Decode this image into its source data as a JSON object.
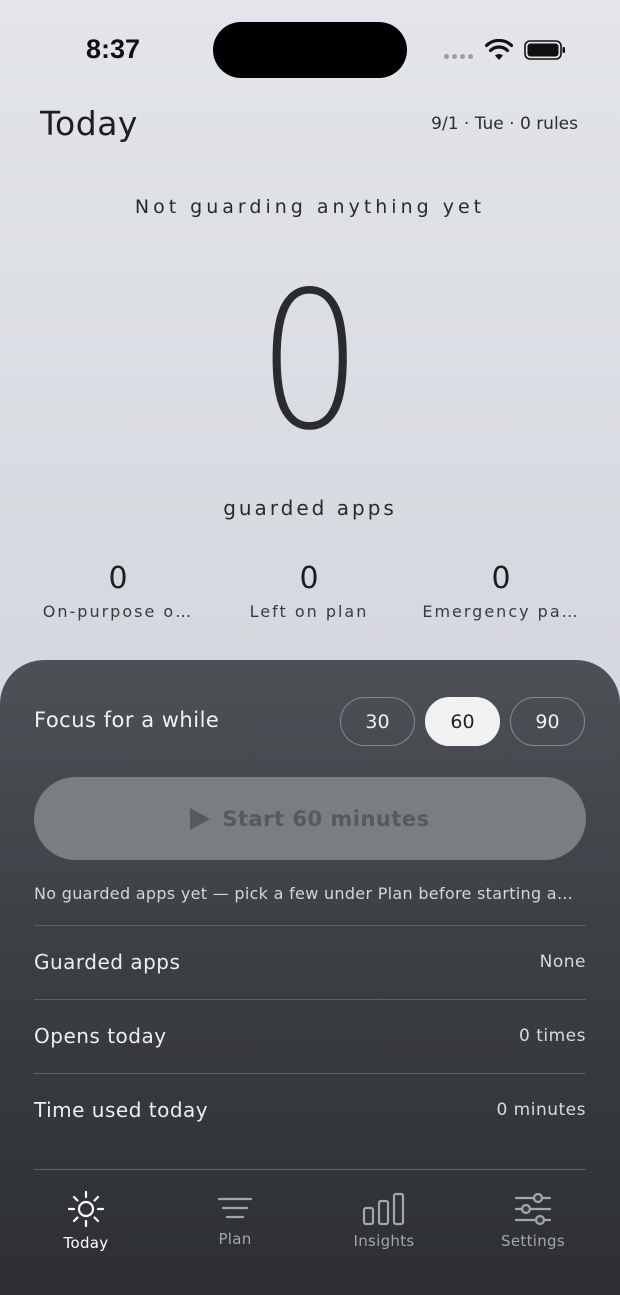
{
  "status_bar": {
    "time": "8:37"
  },
  "header": {
    "title": "Today",
    "date_rules": "9/1 · Tue · 0 rules"
  },
  "hero": {
    "status": "Not guarding anything yet",
    "count": "0",
    "count_label": "guarded apps"
  },
  "stats": [
    {
      "value": "0",
      "label": "On-purpose o…"
    },
    {
      "value": "0",
      "label": "Left on plan"
    },
    {
      "value": "0",
      "label": "Emergency pa…"
    }
  ],
  "focus": {
    "label": "Focus for a while",
    "durations": [
      "30",
      "60",
      "90"
    ],
    "selected_duration": "60",
    "start_label": "Start 60 minutes",
    "hint": "No guarded apps yet — pick a few under Plan before starting a…"
  },
  "info_rows": [
    {
      "label": "Guarded apps",
      "value": "None"
    },
    {
      "label": "Opens today",
      "value": "0 times"
    },
    {
      "label": "Time used today",
      "value": "0 minutes"
    }
  ],
  "tabs": [
    {
      "label": "Today",
      "icon": "sun-icon",
      "active": true
    },
    {
      "label": "Plan",
      "icon": "menu-lines-icon",
      "active": false
    },
    {
      "label": "Insights",
      "icon": "bar-chart-icon",
      "active": false
    },
    {
      "label": "Settings",
      "icon": "sliders-icon",
      "active": false
    }
  ],
  "colors": {
    "panel": "#3c3f44",
    "background": "#d6d9df",
    "selected_pill": "#f2f2f3",
    "disabled_button": "#7a7d82"
  }
}
